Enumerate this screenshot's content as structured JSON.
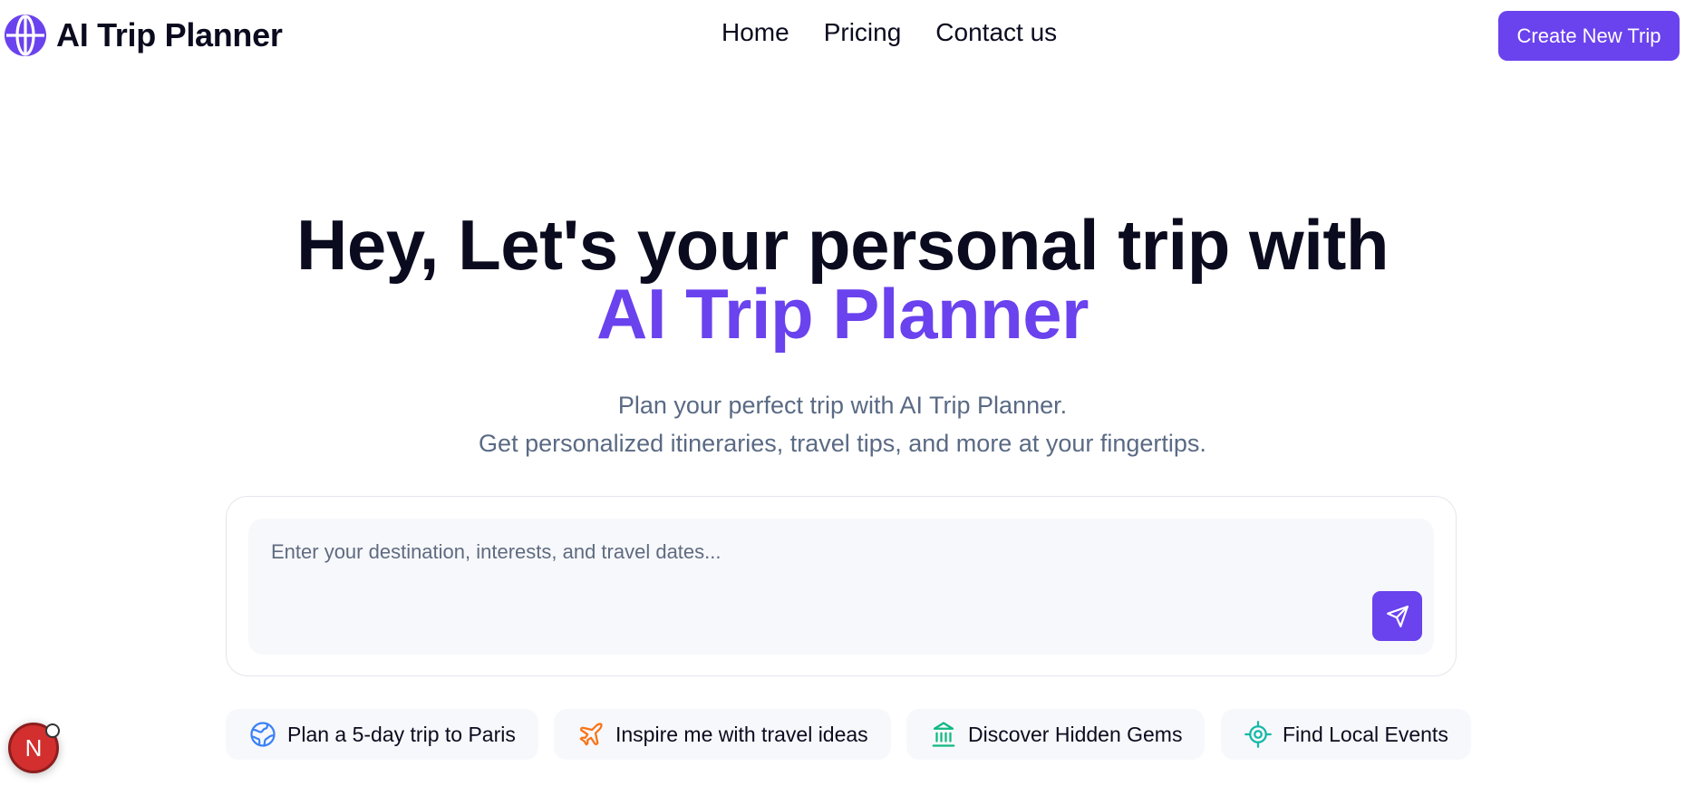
{
  "header": {
    "brand_name": "AI Trip Planner",
    "logo_icon": "globe-icon",
    "nav": [
      {
        "label": "Home"
      },
      {
        "label": "Pricing"
      },
      {
        "label": "Contact us"
      }
    ],
    "cta_label": "Create New Trip"
  },
  "hero": {
    "title_line1": "Hey, Let's your personal trip with",
    "title_accent": "AI Trip Planner",
    "subtitle_line1": "Plan your perfect trip with AI Trip Planner.",
    "subtitle_line2": "Get personalized itineraries, travel tips, and more at your fingertips."
  },
  "prompt": {
    "placeholder": "Enter your destination, interests, and travel dates...",
    "value": "",
    "send_icon": "send-icon"
  },
  "suggestions": [
    {
      "label": "Plan a 5-day trip to Paris",
      "icon": "globe-icon",
      "color": "#3b82f6"
    },
    {
      "label": "Inspire me with travel ideas",
      "icon": "plane-icon",
      "color": "#f97316"
    },
    {
      "label": "Discover Hidden Gems",
      "icon": "landmark-icon",
      "color": "#10b981"
    },
    {
      "label": "Find Local Events",
      "icon": "target-icon",
      "color": "#14b8a6"
    }
  ],
  "badge": {
    "letter": "N"
  },
  "colors": {
    "accent": "#6a42ee",
    "text": "#0b0b1f",
    "muted": "#5a6a84",
    "chip_bg": "#f7f8fb"
  }
}
